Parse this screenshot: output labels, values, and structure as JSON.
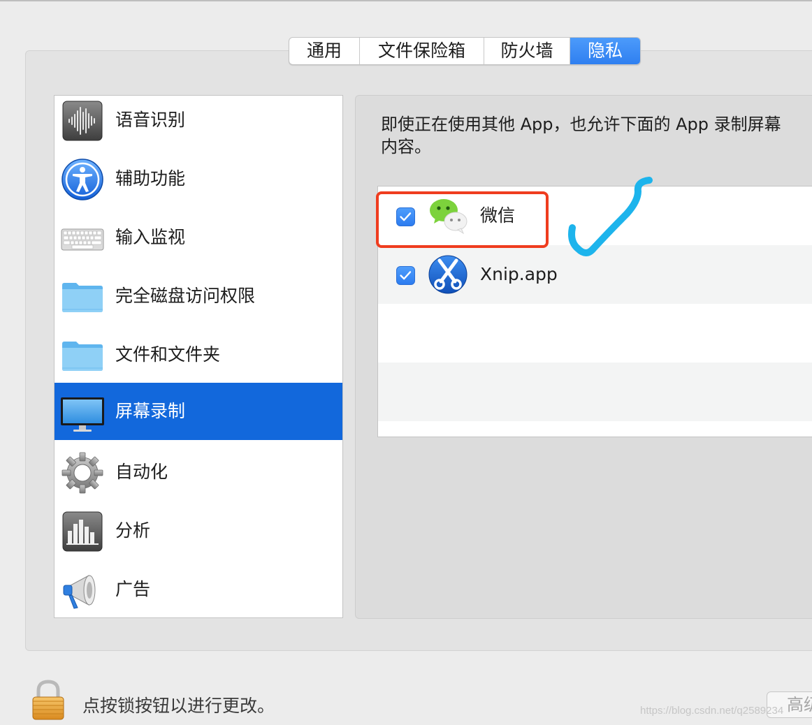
{
  "tabs": [
    {
      "label": "通用",
      "active": false
    },
    {
      "label": "文件保险箱",
      "active": false
    },
    {
      "label": "防火墙",
      "active": false
    },
    {
      "label": "隐私",
      "active": true
    }
  ],
  "sidebar": {
    "items": [
      {
        "label": "语音识别",
        "icon": "waveform-icon"
      },
      {
        "label": "辅助功能",
        "icon": "accessibility-icon"
      },
      {
        "label": "输入监视",
        "icon": "keyboard-icon"
      },
      {
        "label": "完全磁盘访问权限",
        "icon": "folder-icon"
      },
      {
        "label": "文件和文件夹",
        "icon": "folder-icon"
      },
      {
        "label": "屏幕录制",
        "icon": "display-icon",
        "selected": true
      },
      {
        "label": "自动化",
        "icon": "gear-icon"
      },
      {
        "label": "分析",
        "icon": "bar-chart-icon"
      },
      {
        "label": "广告",
        "icon": "megaphone-icon"
      }
    ]
  },
  "panel": {
    "description_line1": "即使正在使用其他 App，也允许下面的 App 录制屏幕",
    "description_line2": "内容。",
    "apps": [
      {
        "name": "微信",
        "checked": true,
        "icon": "wechat-icon"
      },
      {
        "name": "Xnip.app",
        "checked": true,
        "icon": "xnip-scissors-icon"
      }
    ]
  },
  "footer": {
    "lock_text": "点按锁按钮以进行更改。",
    "advanced_label": "高级",
    "watermark": "https://blog.csdn.net/q2589234"
  },
  "colors": {
    "accent": "#2f7ff0",
    "selection": "#1268dc",
    "annotation_red": "#ef3d1f",
    "annotation_blue": "#1db4ec"
  }
}
